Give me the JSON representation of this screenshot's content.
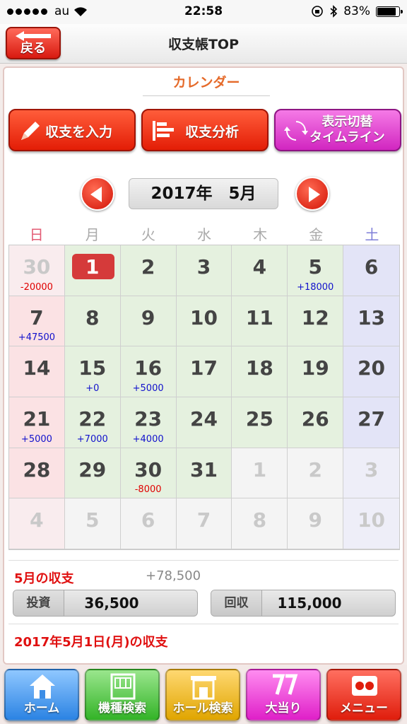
{
  "status": {
    "carrier": "au",
    "time": "22:58",
    "battery": "83%",
    "battery_level": 0.83
  },
  "nav": {
    "back_label": "戻る",
    "title": "収支帳TOP"
  },
  "section": {
    "title": "カレンダー"
  },
  "actions": {
    "input_label": "収支を入力",
    "analysis_label": "収支分析",
    "toggle_line1": "表示切替",
    "toggle_line2": "タイムライン"
  },
  "calendar": {
    "month_label": "2017年　5月",
    "weekdays": [
      "日",
      "月",
      "火",
      "水",
      "木",
      "金",
      "土"
    ],
    "cells": [
      {
        "day": "30",
        "amount": "-20000",
        "other": true
      },
      {
        "day": "1",
        "amount": "",
        "today": true
      },
      {
        "day": "2",
        "amount": ""
      },
      {
        "day": "3",
        "amount": ""
      },
      {
        "day": "4",
        "amount": ""
      },
      {
        "day": "5",
        "amount": "+18000"
      },
      {
        "day": "6",
        "amount": ""
      },
      {
        "day": "7",
        "amount": "+47500"
      },
      {
        "day": "8",
        "amount": ""
      },
      {
        "day": "9",
        "amount": ""
      },
      {
        "day": "10",
        "amount": ""
      },
      {
        "day": "11",
        "amount": ""
      },
      {
        "day": "12",
        "amount": ""
      },
      {
        "day": "13",
        "amount": ""
      },
      {
        "day": "14",
        "amount": ""
      },
      {
        "day": "15",
        "amount": "+0"
      },
      {
        "day": "16",
        "amount": "+5000"
      },
      {
        "day": "17",
        "amount": ""
      },
      {
        "day": "18",
        "amount": ""
      },
      {
        "day": "19",
        "amount": ""
      },
      {
        "day": "20",
        "amount": ""
      },
      {
        "day": "21",
        "amount": "+5000"
      },
      {
        "day": "22",
        "amount": "+7000"
      },
      {
        "day": "23",
        "amount": "+4000"
      },
      {
        "day": "24",
        "amount": ""
      },
      {
        "day": "25",
        "amount": ""
      },
      {
        "day": "26",
        "amount": ""
      },
      {
        "day": "27",
        "amount": ""
      },
      {
        "day": "28",
        "amount": ""
      },
      {
        "day": "29",
        "amount": ""
      },
      {
        "day": "30",
        "amount": "-8000"
      },
      {
        "day": "31",
        "amount": ""
      },
      {
        "day": "1",
        "amount": "",
        "other": true
      },
      {
        "day": "2",
        "amount": "",
        "other": true
      },
      {
        "day": "3",
        "amount": "",
        "other": true
      },
      {
        "day": "4",
        "amount": "",
        "other": true
      },
      {
        "day": "5",
        "amount": "",
        "other": true
      },
      {
        "day": "6",
        "amount": "",
        "other": true
      },
      {
        "day": "7",
        "amount": "",
        "other": true
      },
      {
        "day": "8",
        "amount": "",
        "other": true
      },
      {
        "day": "9",
        "amount": "",
        "other": true
      },
      {
        "day": "10",
        "amount": "",
        "other": true
      }
    ]
  },
  "summary": {
    "label": "5月の収支",
    "total": "+78,500",
    "invest_label": "投資",
    "invest_value": "36,500",
    "collect_label": "回収",
    "collect_value": "115,000"
  },
  "day_detail": {
    "label": "2017年5月1日(月)の収支"
  },
  "tabs": [
    {
      "label": "ホーム",
      "icon": "home-icon"
    },
    {
      "label": "機種検索",
      "icon": "machine-search-icon"
    },
    {
      "label": "ホール検索",
      "icon": "hall-search-icon"
    },
    {
      "label": "大当り",
      "icon": "jackpot-icon"
    },
    {
      "label": "メニュー",
      "icon": "menu-icon"
    }
  ],
  "colors": {
    "accent_red": "#e01010",
    "positive": "#1111cc",
    "negative": "#e00000"
  }
}
